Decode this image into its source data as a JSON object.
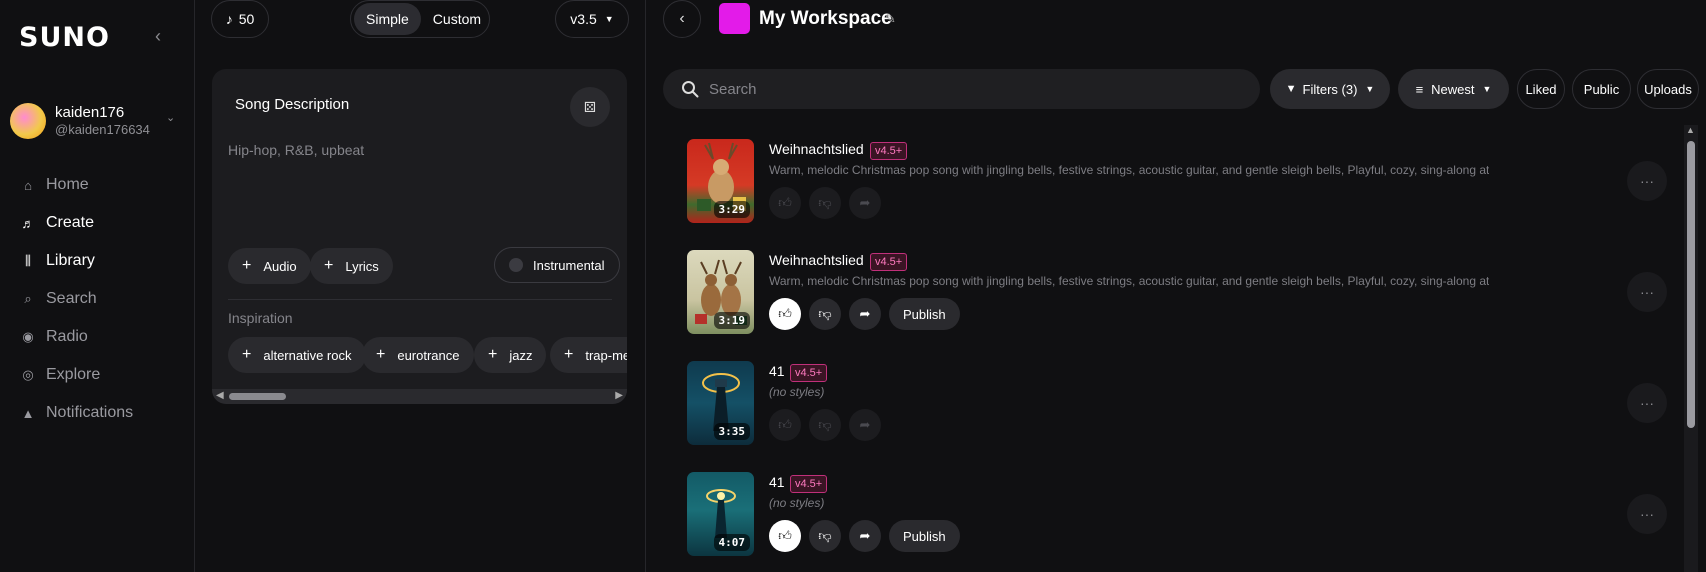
{
  "app": {
    "logo": "SUNO"
  },
  "user": {
    "name": "kaiden176",
    "handle": "@kaiden176634"
  },
  "nav": [
    {
      "label": "Home",
      "icon": "home-icon",
      "active": false
    },
    {
      "label": "Create",
      "icon": "create-icon",
      "active": true
    },
    {
      "label": "Library",
      "icon": "library-icon",
      "active": true
    },
    {
      "label": "Search",
      "icon": "search-icon",
      "active": false
    },
    {
      "label": "Radio",
      "icon": "radio-icon",
      "active": false
    },
    {
      "label": "Explore",
      "icon": "explore-icon",
      "active": false
    },
    {
      "label": "Notifications",
      "icon": "bell-icon",
      "active": false
    }
  ],
  "create": {
    "credits": "50",
    "mode_simple": "Simple",
    "mode_custom": "Custom",
    "version": "v3.5",
    "song_description_label": "Song Description",
    "description_placeholder": "Hip-hop, R&B, upbeat",
    "audio_label": "Audio",
    "lyrics_label": "Lyrics",
    "instrumental_label": "Instrumental",
    "inspiration_label": "Inspiration",
    "inspiration_tags": [
      "alternative rock",
      "eurotrance",
      "jazz",
      "trap-me"
    ]
  },
  "workspace": {
    "title": "My Workspace",
    "search_placeholder": "Search",
    "filters_label": "Filters (3)",
    "sort_label": "Newest",
    "liked_label": "Liked",
    "public_label": "Public",
    "uploads_label": "Uploads",
    "publish_label": "Publish",
    "songs": [
      {
        "title": "Weihnachtslied",
        "badge": "v4.5+",
        "duration": "3:29",
        "description": "Warm, melodic Christmas pop song with jingling bells, festive strings, acoustic guitar, and gentle sleigh bells, Playful, cozy, sing-along atmos...",
        "liked": false,
        "publish": false
      },
      {
        "title": "Weihnachtslied",
        "badge": "v4.5+",
        "duration": "3:19",
        "description": "Warm, melodic Christmas pop song with jingling bells, festive strings, acoustic guitar, and gentle sleigh bells, Playful, cozy, sing-along atmos...",
        "liked": true,
        "publish": true
      },
      {
        "title": "41",
        "badge": "v4.5+",
        "duration": "3:35",
        "description": "(no styles)",
        "liked": false,
        "publish": false
      },
      {
        "title": "41",
        "badge": "v4.5+",
        "duration": "4:07",
        "description": "(no styles)",
        "liked": true,
        "publish": true
      }
    ]
  },
  "colors": {
    "accent_workspace": "#e31be9",
    "badge": "#ff7ac0",
    "background": "#101012"
  }
}
